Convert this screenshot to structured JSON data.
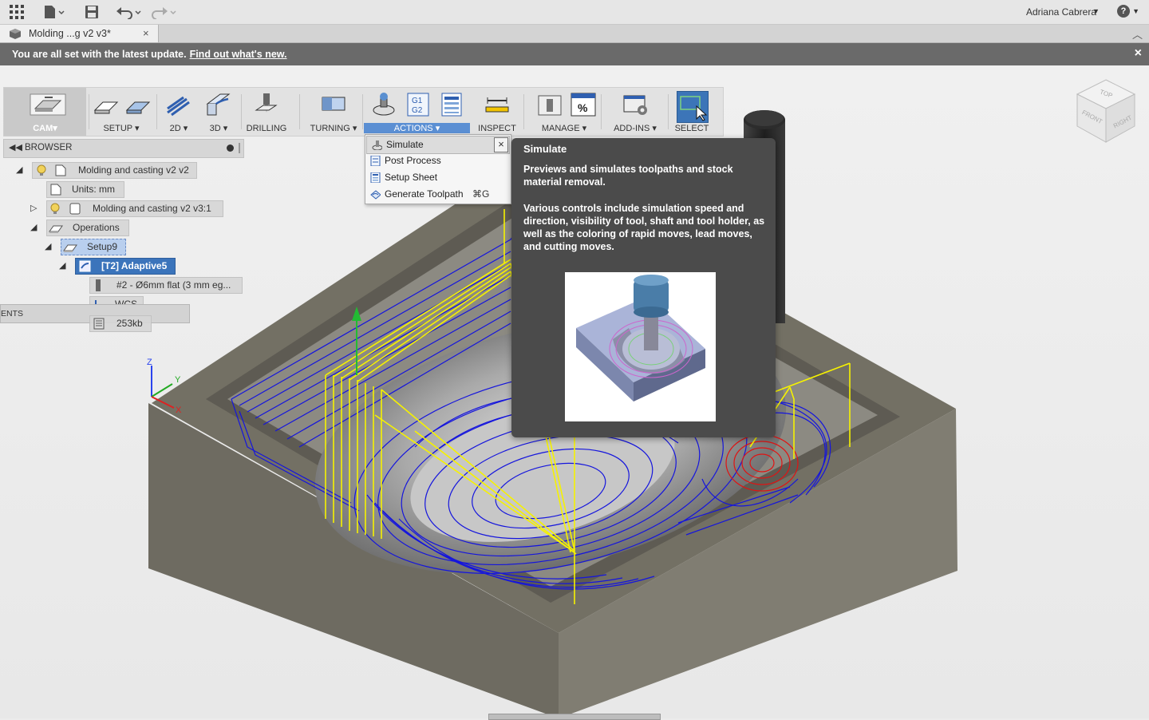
{
  "topbar": {
    "user_name": "Adriana Cabrera",
    "help_label": "?"
  },
  "tab": {
    "title": "Molding ...g v2 v3*",
    "close": "×"
  },
  "notification": {
    "message": "You are all set with the latest update.",
    "link": "Find out what's new.",
    "close": "×"
  },
  "toolbar": {
    "groups": [
      {
        "label": "CAM▾",
        "icon": "cam-workspace-icon"
      },
      {
        "label": "SETUP ▾",
        "icon": "setup-icon"
      },
      {
        "label": "2D ▾",
        "icon": "2d-icon"
      },
      {
        "label": "3D ▾",
        "icon": "3d-icon"
      },
      {
        "label": "DRILLING",
        "icon": "drill-icon"
      },
      {
        "label": "TURNING ▾",
        "icon": "turning-icon"
      },
      {
        "label": "ACTIONS ▾",
        "icon": "actions-icon"
      },
      {
        "label": "INSPECT",
        "icon": "inspect-icon"
      },
      {
        "label": "MANAGE ▾",
        "icon": "manage-icon"
      },
      {
        "label": "ADD-INS ▾",
        "icon": "addins-icon"
      },
      {
        "label": "SELECT",
        "icon": "select-icon"
      }
    ],
    "actions_icon_text": [
      "G1",
      "G2"
    ],
    "manage_icon_text": "%"
  },
  "browser": {
    "title": "BROWSER",
    "nodes": {
      "root": "Molding and casting v2 v2",
      "units": "Units: mm",
      "component": "Molding and casting v2 v3:1",
      "operations": "Operations",
      "setup": "Setup9",
      "adaptive": "[T2] Adaptive5",
      "tool": "#2 - Ø6mm flat (3 mm eg...",
      "wcs": "WCS",
      "size": "253kb"
    },
    "comments_label": "ENTS"
  },
  "actions_menu": {
    "items": [
      {
        "label": "Simulate",
        "shortcut": ""
      },
      {
        "label": "Post Process",
        "shortcut": ""
      },
      {
        "label": "Setup Sheet",
        "shortcut": ""
      },
      {
        "label": "Generate Toolpath",
        "shortcut": "⌘G"
      }
    ],
    "close": "×"
  },
  "tooltip": {
    "title": "Simulate",
    "description": "Previews and simulates toolpaths and stock material removal.",
    "details": "Various controls include simulation speed and direction, visibility of tool, shaft and tool holder, as well as the coloring of rapid moves, lead moves, and cutting moves."
  },
  "viewcube": {
    "top": "TOP",
    "front": "FRONT",
    "right": "RIGHT"
  },
  "axes": {
    "x": "X",
    "y": "Y",
    "z": "Z"
  },
  "colors": {
    "accent": "#3b74bb",
    "toolpath_cut": "#1010d8",
    "toolpath_rapid": "#ffff00",
    "toolpath_lead": "#e01010",
    "stock": "#6e6b61"
  }
}
